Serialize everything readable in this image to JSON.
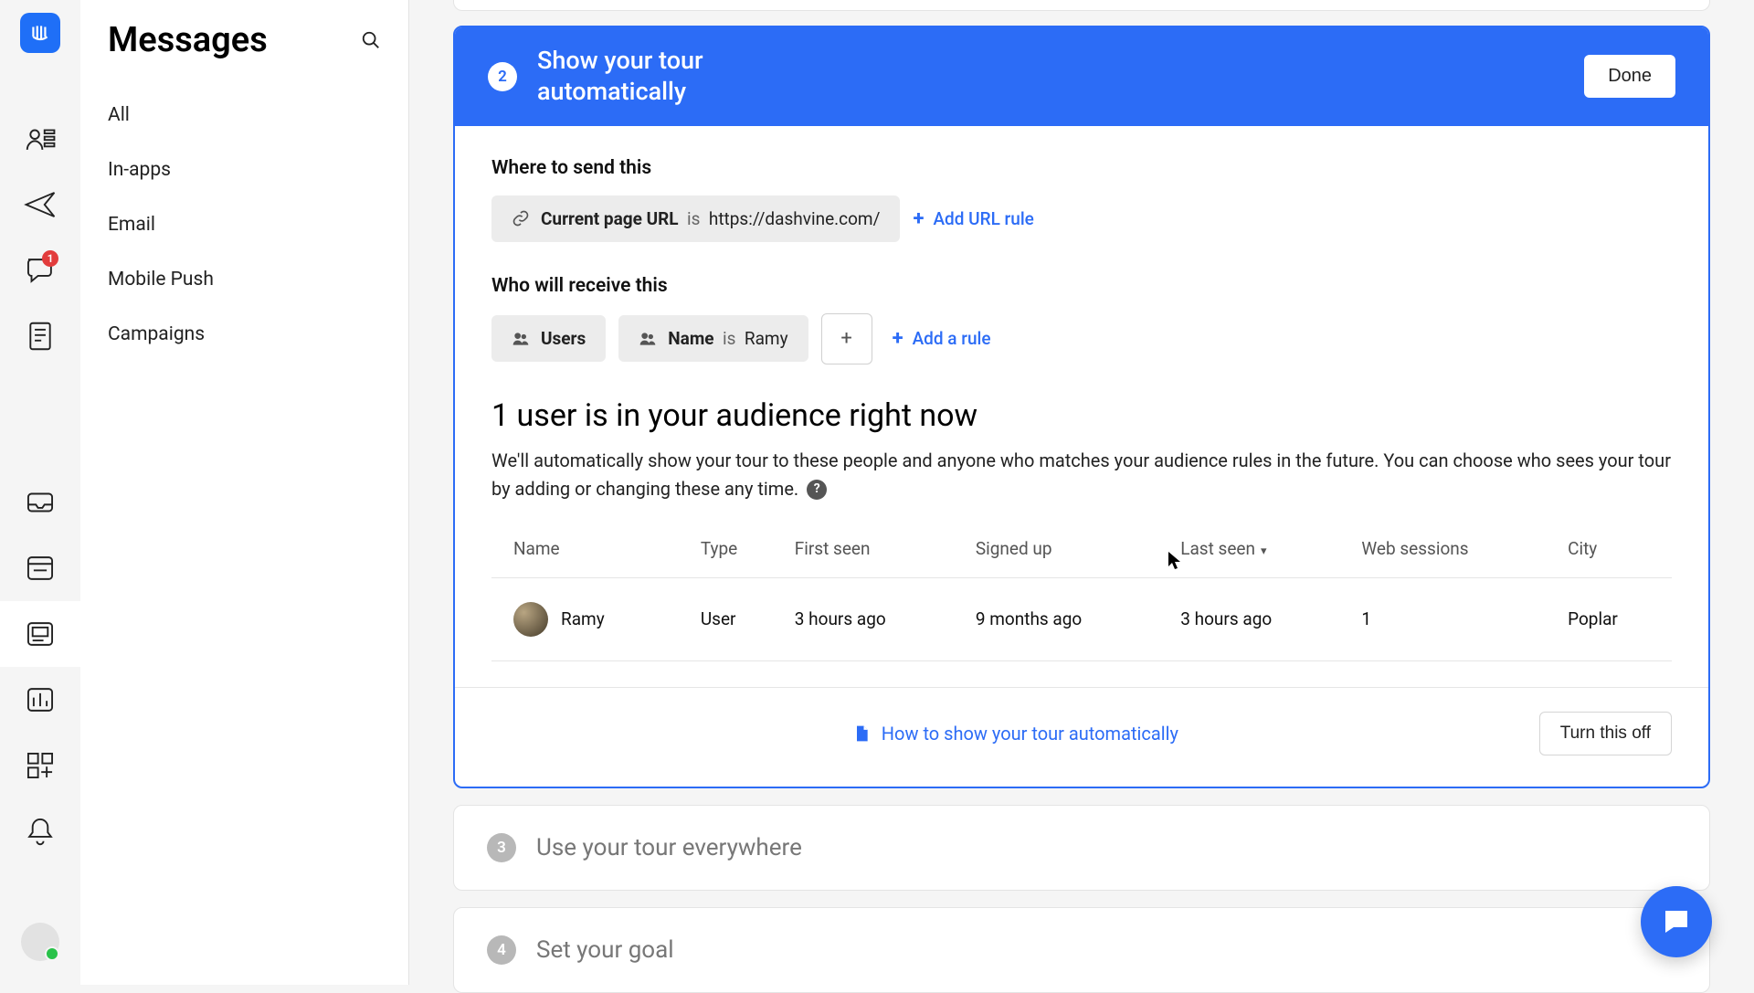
{
  "sidepanel": {
    "title": "Messages",
    "items": [
      "All",
      "In-apps",
      "Email",
      "Mobile Push",
      "Campaigns"
    ]
  },
  "rail": {
    "badge": "1"
  },
  "step2": {
    "number": "2",
    "title": "Show your tour automatically",
    "done": "Done",
    "where_label": "Where to send this",
    "url_chip_prefix": "Current page URL",
    "url_chip_is": "is",
    "url_chip_value": "https://dashvine.com/",
    "add_url_rule": "Add URL rule",
    "who_label": "Who will receive this",
    "filters": [
      {
        "label": "Users"
      },
      {
        "label_pre": "Name",
        "is": "is",
        "label_val": "Ramy"
      }
    ],
    "add_rule": "Add a rule",
    "audience_heading": "1 user is in your audience right now",
    "audience_desc": "We'll automatically show your tour to these people and anyone who matches your audience rules in the future. You can choose who sees your tour by adding or changing these any time.",
    "table": {
      "columns": [
        "Name",
        "Type",
        "First seen",
        "Signed up",
        "Last seen",
        "Web sessions",
        "City"
      ],
      "rows": [
        {
          "name": "Ramy",
          "type": "User",
          "first_seen": "3 hours ago",
          "signed_up": "9 months ago",
          "last_seen": "3 hours ago",
          "web_sessions": "1",
          "city": "Poplar"
        }
      ]
    },
    "howto": "How to show your tour automatically",
    "turn_off": "Turn this off"
  },
  "step3": {
    "number": "3",
    "title": "Use your tour everywhere"
  },
  "step4": {
    "number": "4",
    "title": "Set your goal"
  }
}
